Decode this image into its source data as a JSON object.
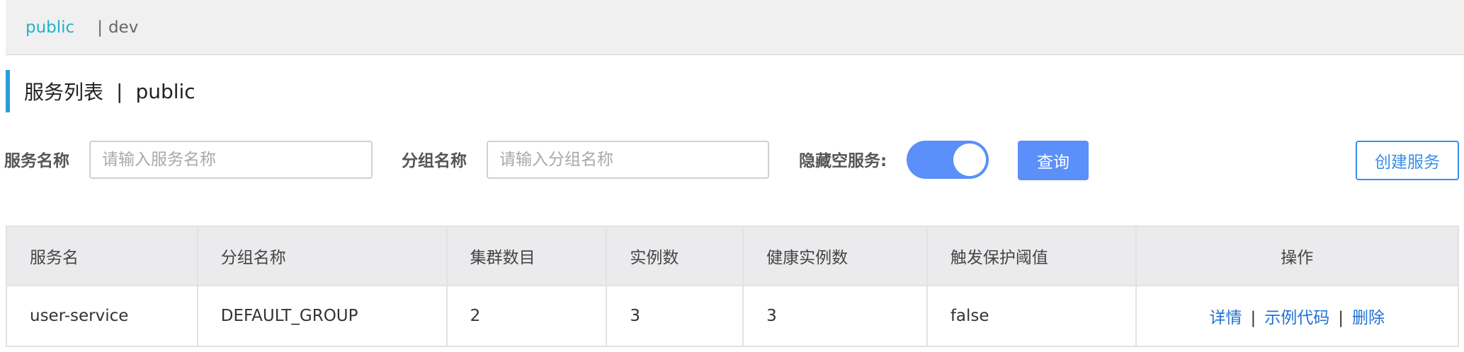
{
  "namespaces": {
    "active": "public",
    "separator": "|",
    "other": "dev"
  },
  "header": {
    "title": "服务列表",
    "separator": "|",
    "namespace": "public"
  },
  "search": {
    "service_label": "服务名称",
    "service_placeholder": "请输入服务名称",
    "group_label": "分组名称",
    "group_placeholder": "请输入分组名称",
    "hide_empty_label": "隐藏空服务:",
    "hide_empty_on": true,
    "query_button": "查询",
    "create_button": "创建服务"
  },
  "table": {
    "columns": [
      "服务名",
      "分组名称",
      "集群数目",
      "实例数",
      "健康实例数",
      "触发保护阈值",
      "操作"
    ],
    "rows": [
      {
        "name": "user-service",
        "group": "DEFAULT_GROUP",
        "clusters": "2",
        "instances": "3",
        "healthy": "3",
        "threshold": "false",
        "actions": {
          "detail": "详情",
          "sample": "示例代码",
          "delete": "删除",
          "sep": "|"
        }
      }
    ]
  },
  "colors": {
    "accent_cyan": "#1fb3c8",
    "primary_blue": "#5b8ff9",
    "link_blue": "#1f72d4",
    "title_bar": "#2a9dd8"
  }
}
